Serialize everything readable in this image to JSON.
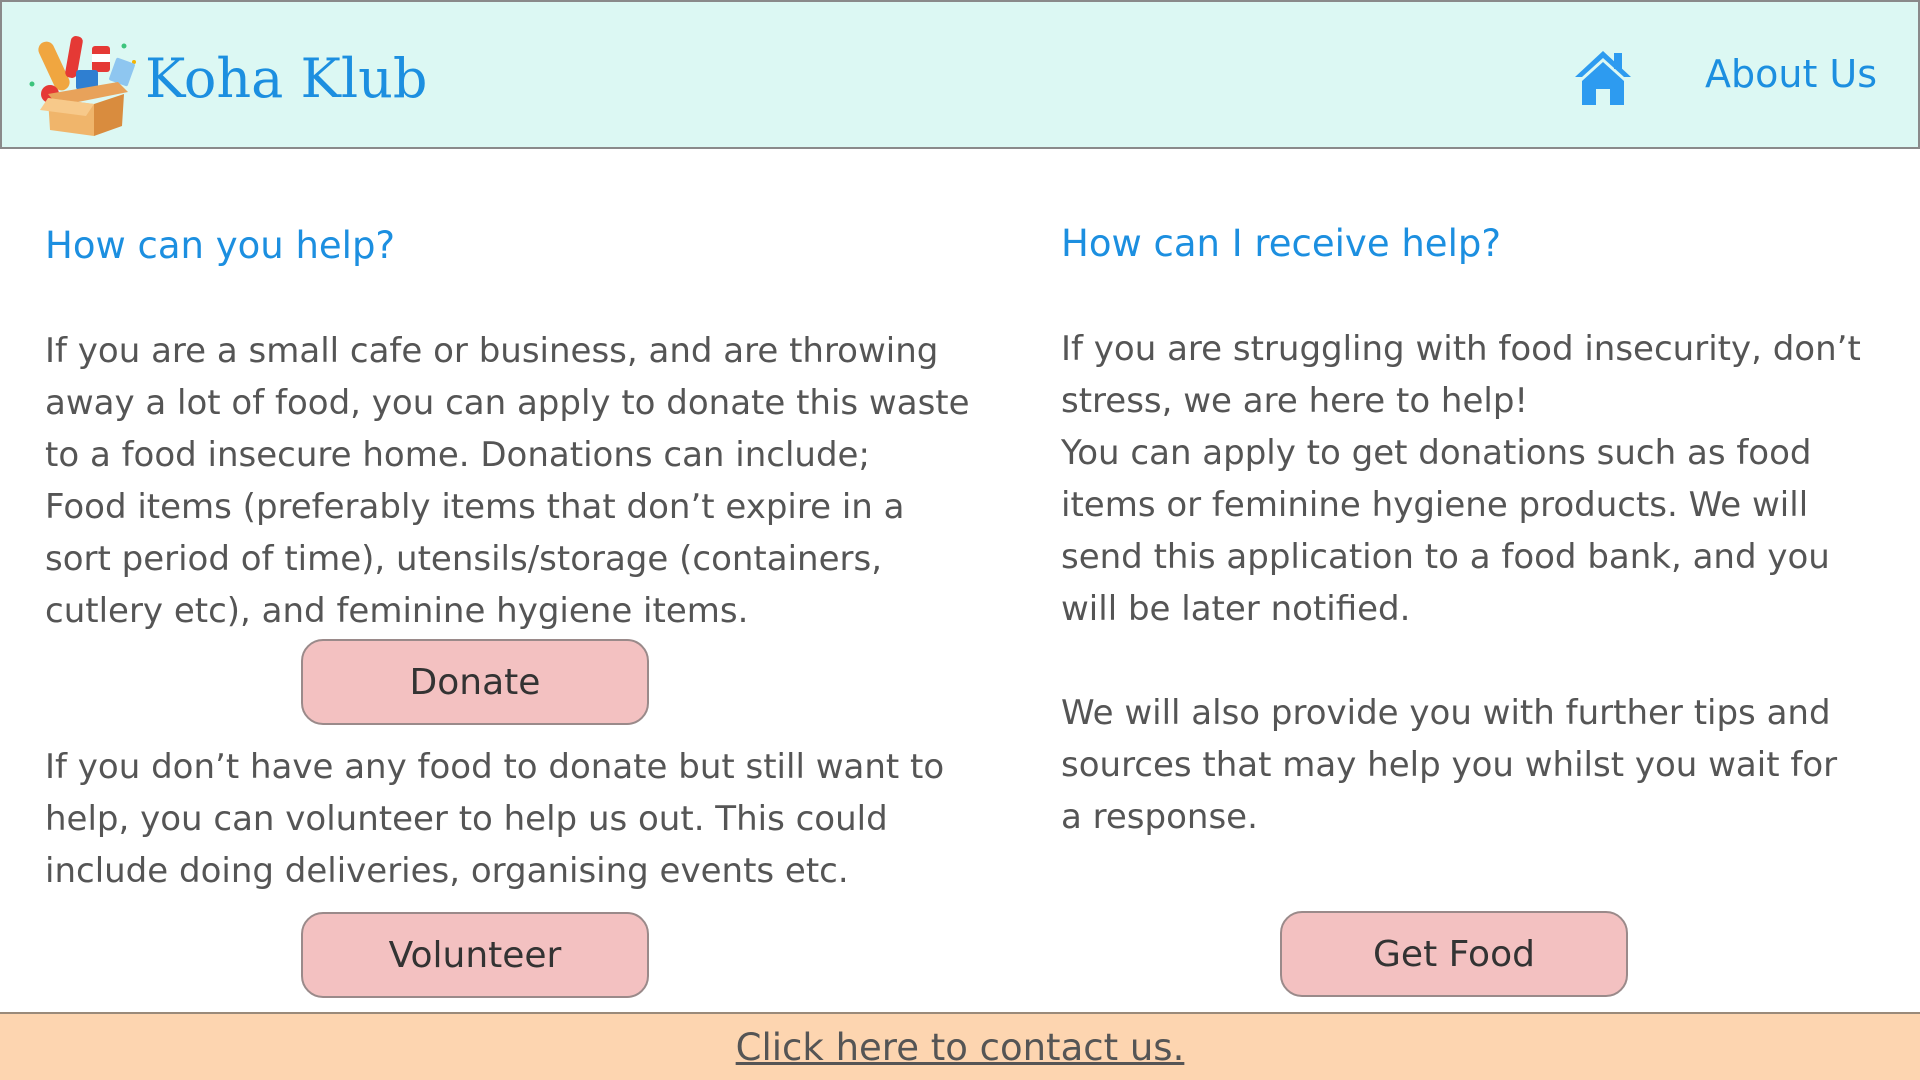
{
  "header": {
    "brand": "Koha Klub",
    "logo_icon": "food-donation-box-icon",
    "home_icon": "home-icon",
    "about_label": "About Us",
    "accent_color": "#1c8fe0",
    "background_color": "#dcf8f3"
  },
  "left": {
    "heading": "How can you help?",
    "para1": "If you are a small cafe or business, and are throwing\naway a lot of food, you can apply to donate this waste\nto a food insecure home. Donations can include;\nFood items (preferably items that don’t expire in a\nsort period of time), utensils/storage (containers,\ncutlery etc), and feminine hygiene items.",
    "donate_label": "Donate",
    "para2": "If you don’t have any food to donate but still want to\nhelp, you can volunteer to help us out. This could\ninclude doing deliveries, organising events etc.",
    "volunteer_label": "Volunteer"
  },
  "right": {
    "heading": "How can I receive help?",
    "para1": "If you are struggling with food insecurity, don’t\nstress, we are here to help!\nYou can apply to get donations such as food\nitems or feminine hygiene products. We will\nsend this application to a food bank, and you\nwill be later notified.",
    "para2": "We will also provide you with further tips and\nsources that may help you whilst you wait for\na response.",
    "get_food_label": "Get Food"
  },
  "buttons": {
    "color": "#f3c1c1"
  },
  "footer": {
    "contact_label": "Click here to contact us.",
    "background_color": "#fdd5b0"
  }
}
